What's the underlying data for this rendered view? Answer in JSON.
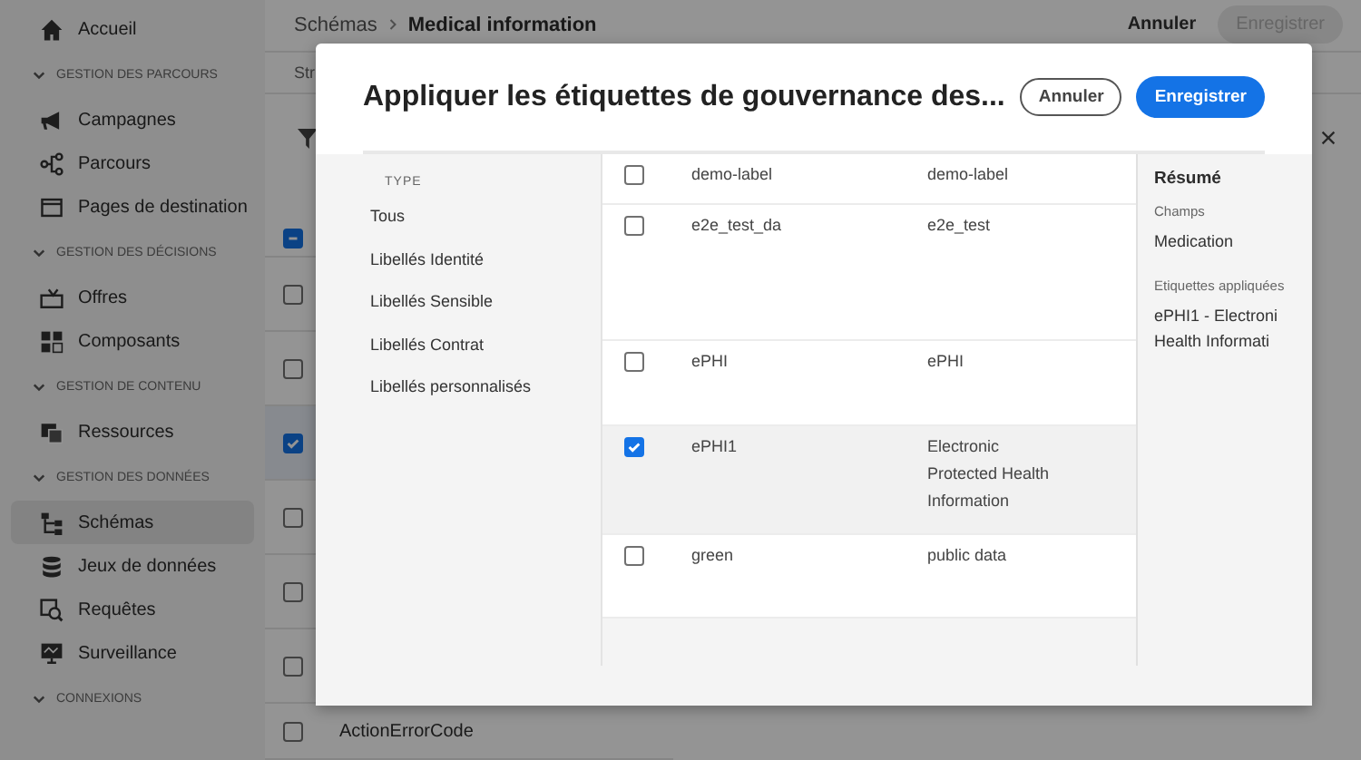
{
  "sidebar": {
    "items": [
      {
        "kind": "link",
        "label": "Accueil",
        "selected": false
      },
      {
        "kind": "section",
        "label": "GESTION DES PARCOURS"
      },
      {
        "kind": "link",
        "label": "Campagnes",
        "selected": false
      },
      {
        "kind": "link",
        "label": "Parcours",
        "selected": false
      },
      {
        "kind": "link",
        "label": "Pages de destination",
        "selected": false
      },
      {
        "kind": "section",
        "label": "GESTION DES DÉCISIONS"
      },
      {
        "kind": "link",
        "label": "Offres",
        "selected": false
      },
      {
        "kind": "link",
        "label": "Composants",
        "selected": false
      },
      {
        "kind": "section",
        "label": "GESTION DE CONTENU"
      },
      {
        "kind": "link",
        "label": "Ressources",
        "selected": false
      },
      {
        "kind": "section",
        "label": "GESTION DES DONNÉES"
      },
      {
        "kind": "link",
        "label": "Schémas",
        "selected": true
      },
      {
        "kind": "link",
        "label": "Jeux de données",
        "selected": false
      },
      {
        "kind": "link",
        "label": "Requêtes",
        "selected": false
      },
      {
        "kind": "link",
        "label": "Surveillance",
        "selected": false
      },
      {
        "kind": "section",
        "label": "CONNEXIONS"
      }
    ]
  },
  "header": {
    "breadcrumb": [
      "Schémas",
      "Medical information"
    ],
    "cancel": "Annuler",
    "save": "Enregistrer",
    "save_disabled": true,
    "tab_fragment": "Str"
  },
  "select_all": {
    "indeterminate": true
  },
  "background_rows": [
    {
      "checked": false
    },
    {
      "checked": false
    },
    {
      "checked": true
    },
    {
      "checked": false
    },
    {
      "checked": false
    },
    {
      "checked": false
    },
    {
      "checked": false,
      "label": "ActionErrorCode"
    }
  ],
  "dialog": {
    "title": "Appliquer les étiquettes de gouvernance des...",
    "cancel": "Annuler",
    "save": "Enregistrer",
    "filter": {
      "heading": "TYPE",
      "items": [
        "Tous",
        "Libellés Identité",
        "Libellés Sensible",
        "Libellés Contrat",
        "Libellés personnalisés"
      ]
    },
    "rows": [
      {
        "checked": false,
        "name": "demo-label",
        "friendly_name": "demo-label"
      },
      {
        "checked": false,
        "name": "e2e_test_da",
        "friendly_name": "e2e_test"
      },
      {
        "checked": false,
        "name": "ePHI",
        "friendly_name": "ePHI"
      },
      {
        "checked": true,
        "name": "ePHI1",
        "friendly_name": "Electronic Protected Health Information"
      },
      {
        "checked": false,
        "name": "green",
        "friendly_name": "public data"
      }
    ],
    "summary": {
      "title": "Résumé",
      "fields_label": "Champs",
      "fields": [
        "Medication"
      ],
      "applied_label": "Etiquettes appliquées",
      "applied": [
        "ePHI1 - Electroni",
        "Health Informati"
      ]
    }
  }
}
